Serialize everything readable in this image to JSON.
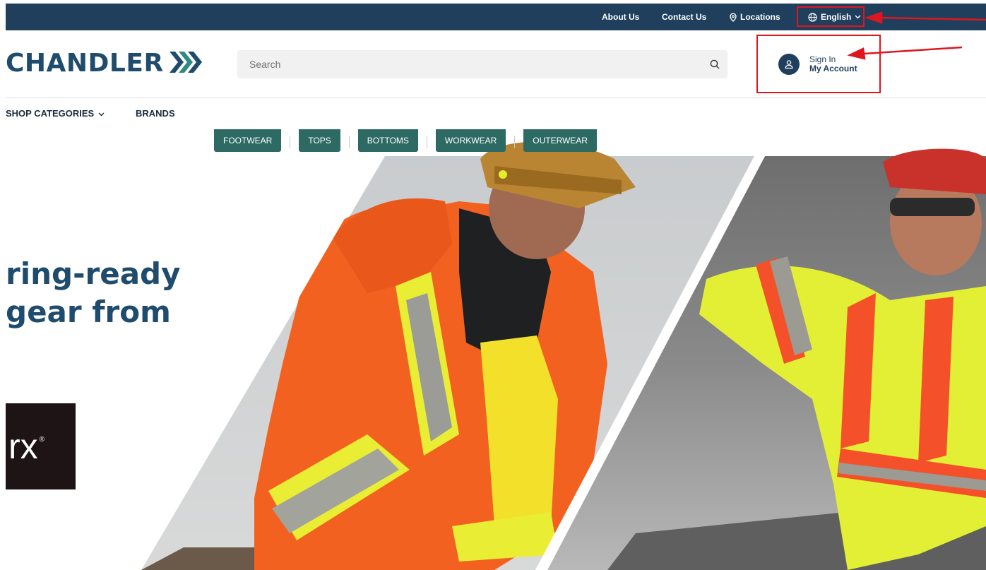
{
  "topbar": {
    "about": "About Us",
    "contact": "Contact Us",
    "locations": "Locations",
    "language": "English"
  },
  "header": {
    "logo_text": "CHANDLER",
    "search_placeholder": "Search",
    "account_line1": "Sign In",
    "account_line2": "My Account"
  },
  "nav": {
    "shop_categories": "SHOP CATEGORIES",
    "brands": "BRANDS"
  },
  "categories": [
    "FOOTWEAR",
    "TOPS",
    "BOTTOMS",
    "WORKWEAR",
    "OUTERWEAR"
  ],
  "hero": {
    "line1": "ring-ready",
    "line2": "gear from",
    "badge": "rx",
    "badge_mark": "®"
  },
  "colors": {
    "brand_navy": "#1f3f5d",
    "brand_teal": "#2e6a64",
    "annotation_red": "#e0161e"
  },
  "icons": {
    "locations": "map-pin-icon",
    "language": "globe-icon",
    "search": "search-icon",
    "account": "user-icon"
  }
}
